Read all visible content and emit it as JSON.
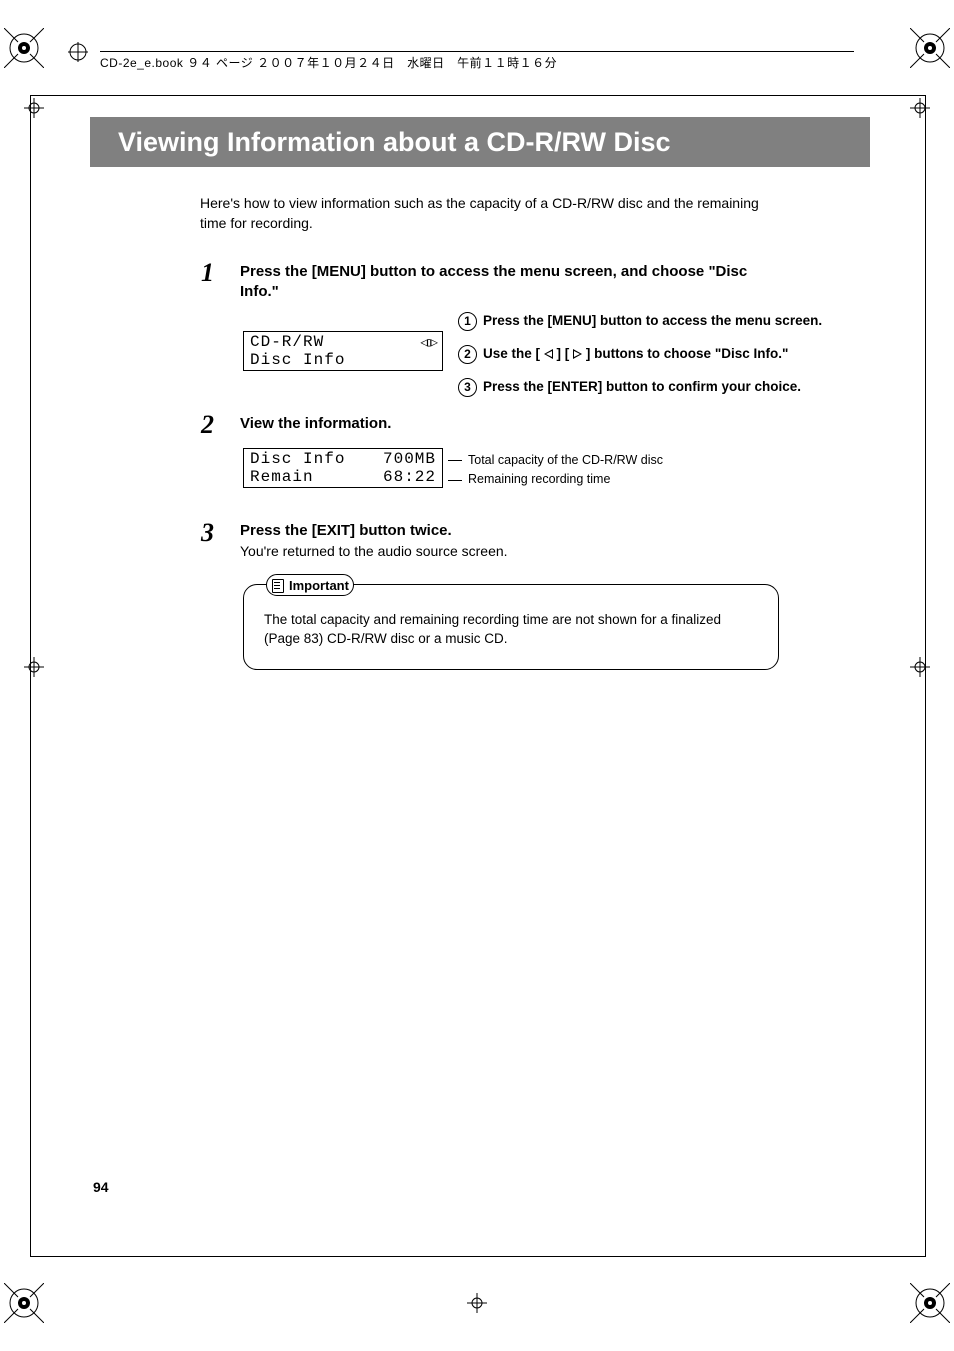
{
  "header": {
    "running": "CD-2e_e.book ９４ ページ ２００７年１０月２４日　水曜日　午前１１時１６分"
  },
  "title": "Viewing Information about a CD-R/RW Disc",
  "intro": "Here's how to view information such as the capacity of a CD-R/RW disc and the remaining time for recording.",
  "steps": {
    "s1": {
      "num": "1",
      "text": "Press the [MENU] button to access the menu screen, and choose \"Disc Info.\"",
      "lcd_line1": "CD-R/RW",
      "lcd_line2": "Disc Info",
      "subs": {
        "a_num": "1",
        "a": "Press the [MENU] button to access the menu screen.",
        "b_num": "2",
        "b_pre": "Use the [",
        "b_mid": "] [",
        "b_post": "] buttons to choose \"Disc Info.\"",
        "c_num": "3",
        "c": "Press the [ENTER] button to confirm your choice."
      }
    },
    "s2": {
      "num": "2",
      "text": "View the information.",
      "lcd_l1a": "Disc Info",
      "lcd_l1b": "700MB",
      "lcd_l2a": "Remain",
      "lcd_l2b": "68:22",
      "annot1": "Total capacity of the CD-R/RW disc",
      "annot2": "Remaining recording time"
    },
    "s3": {
      "num": "3",
      "text": "Press the [EXIT] button twice.",
      "sub": "You're returned to the audio source screen."
    }
  },
  "important": {
    "label": "Important",
    "body": "The total capacity and remaining recording time are not shown for a finalized (Page 83) CD-R/RW disc or a music CD."
  },
  "page_number": "94"
}
